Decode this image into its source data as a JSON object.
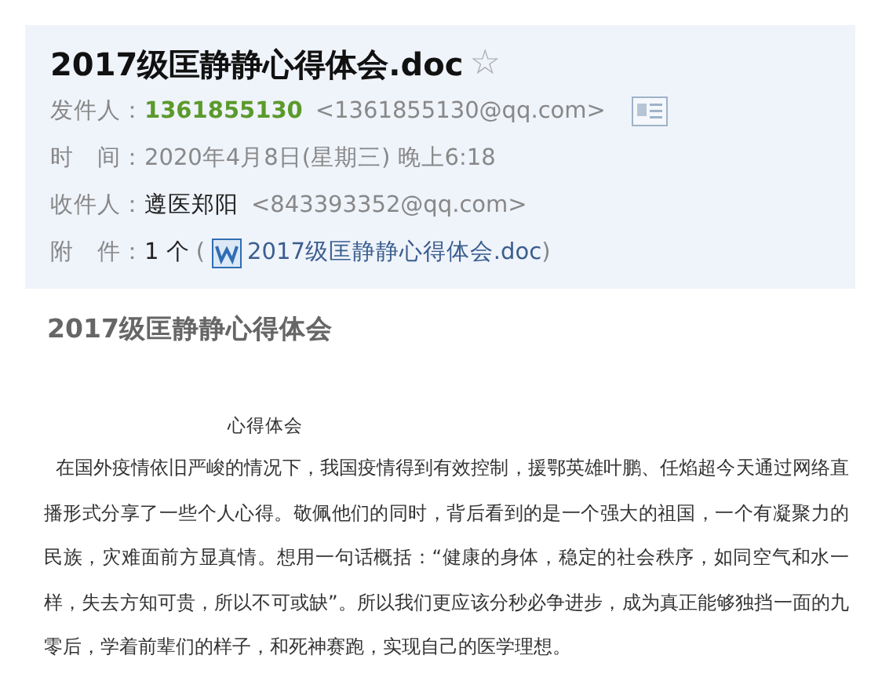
{
  "header": {
    "title": "2017级匡静静心得体会.doc",
    "star": "☆",
    "fields": [
      {
        "kind": "sender",
        "label": "发件人：",
        "name": "1361855130",
        "address": "<1361855130@qq.com>"
      },
      {
        "kind": "time",
        "label": "时　间：",
        "value": "2020年4月8日(星期三) 晚上6:18"
      },
      {
        "kind": "recipient",
        "label": "收件人：",
        "name": "遵医郑阳",
        "address": "<843393352@qq.com>"
      },
      {
        "kind": "attachment",
        "label": "附　件：",
        "count": "1 个",
        "open": "(",
        "file": "2017级匡静静心得体会.doc",
        "close": ")"
      }
    ]
  },
  "document": {
    "heading": "2017级匡静静心得体会",
    "subtitle": "心得体会",
    "paragraph": "在国外疫情依旧严峻的情况下，我国疫情得到有效控制，援鄂英雄叶鹏、任焰超今天通过网络直播形式分享了一些个人心得。敬佩他们的同时，背后看到的是一个强大的祖国，一个有凝聚力的民族，灾难面前方显真情。想用一句话概括：“健康的身体，稳定的社会秩序，如同空气和水一样，失去方知可贵，所以不可或缺”。所以我们更应该分秒必争进步，成为真正能够独挡一面的九零后，学着前辈们的样子，和死神赛跑，实现自己的医学理想。"
  }
}
